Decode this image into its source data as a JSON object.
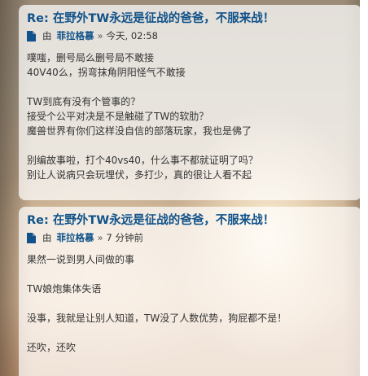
{
  "posts": [
    {
      "title": "Re: 在野外TW永远是征战的爸爸，不服来战！",
      "by_label": "由",
      "author": "菲拉格慕",
      "separator": "»",
      "time": "今天, 02:58",
      "lines": [
        "噗嗤，删号局么删号局不敢接",
        "40V40么，拐弯抹角阴阳怪气不敢接",
        "",
        "TW到底有没有个管事的？",
        "接受个公平对决是不是触碰了TW的软肋？",
        "魔兽世界有你们这样没自信的部落玩家，我也是佛了",
        "",
        "别编故事啦，打个40vs40，什么事不都就证明了吗？",
        "别让人说病只会玩埋伏，多打少，真的很让人看不起"
      ]
    },
    {
      "title": "Re: 在野外TW永远是征战的爸爸，不服来战！",
      "by_label": "由",
      "author": "菲拉格慕",
      "separator": "»",
      "time": "7 分钟前",
      "lines": [
        "果然一说到男人间做的事",
        "",
        "TW娘炮集体失语",
        "",
        "没事，我就是让别人知道，TW没了人数优势，狗屁都不是！",
        "",
        "还吹，还吹"
      ]
    }
  ],
  "icons": {
    "post_icon": "document-icon"
  },
  "colors": {
    "title": "#105289",
    "text": "#333333",
    "card": "rgba(255,255,255,0.72)"
  }
}
